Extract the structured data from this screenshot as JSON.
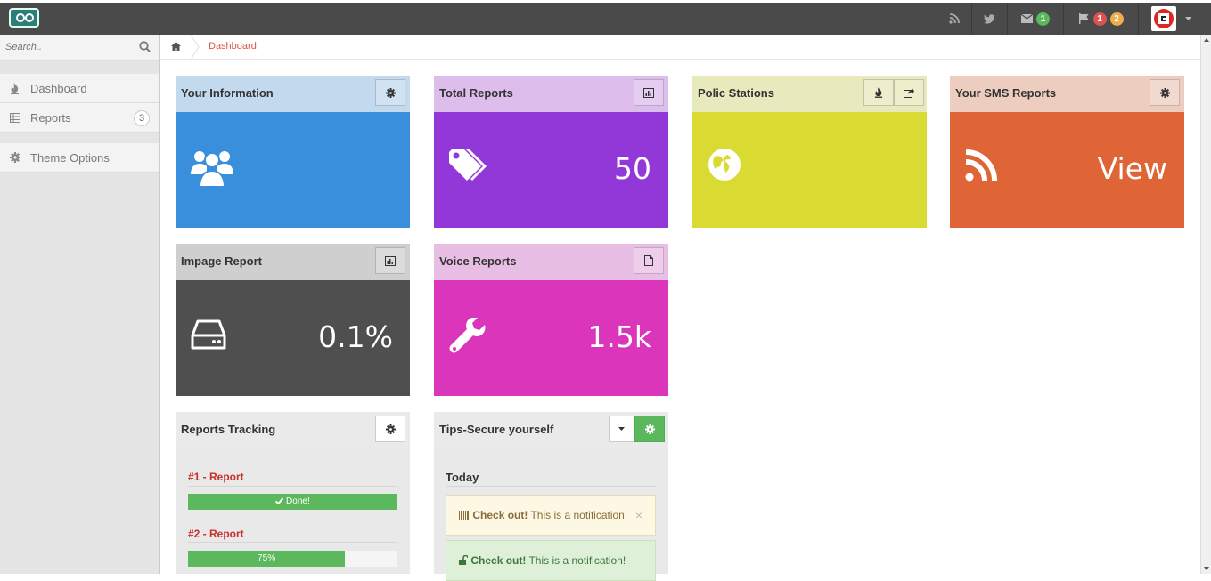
{
  "search": {
    "placeholder": "Search.."
  },
  "sidebar": {
    "items": [
      {
        "label": "Dashboard",
        "icon": "fire-icon"
      },
      {
        "label": "Reports",
        "icon": "table-icon",
        "badge": "3"
      },
      {
        "label": "Theme Options",
        "icon": "gear-icon"
      }
    ]
  },
  "topbar": {
    "mail_count": "1",
    "flag_count_red": "1",
    "flag_count_orange": "2"
  },
  "breadcrumb": {
    "current": "Dashboard"
  },
  "widgets": {
    "your_information": {
      "title": "Your Information"
    },
    "total_reports": {
      "title": "Total Reports",
      "value": "50"
    },
    "police_stations": {
      "title": "Polic Stations"
    },
    "sms_reports": {
      "title": "Your SMS Reports",
      "value": "View"
    },
    "image_report": {
      "title": "Impage Report",
      "value": "0.1%"
    },
    "voice_reports": {
      "title": "Voice Reports",
      "value": "1.5k"
    },
    "reports_tracking": {
      "title": "Reports Tracking",
      "items": [
        {
          "title": "#1 - Report",
          "progress_label": "Done!",
          "progress": 100
        },
        {
          "title": "#2 - Report",
          "progress_label": "75%",
          "progress": 75
        }
      ]
    },
    "tips": {
      "title": "Tips-Secure yourself",
      "section": "Today",
      "notifications": [
        {
          "strong": "Check out!",
          "text": " This is a notification!",
          "type": "warning"
        },
        {
          "strong": "Check out!",
          "text": " This is a notification!",
          "type": "success"
        }
      ]
    }
  },
  "colors": {
    "blue": "#3a8fdc",
    "purple": "#9238d8",
    "yellow": "#d9db33",
    "orange": "#e06536",
    "dark": "#4f4f4f",
    "magenta": "#db35bc"
  }
}
